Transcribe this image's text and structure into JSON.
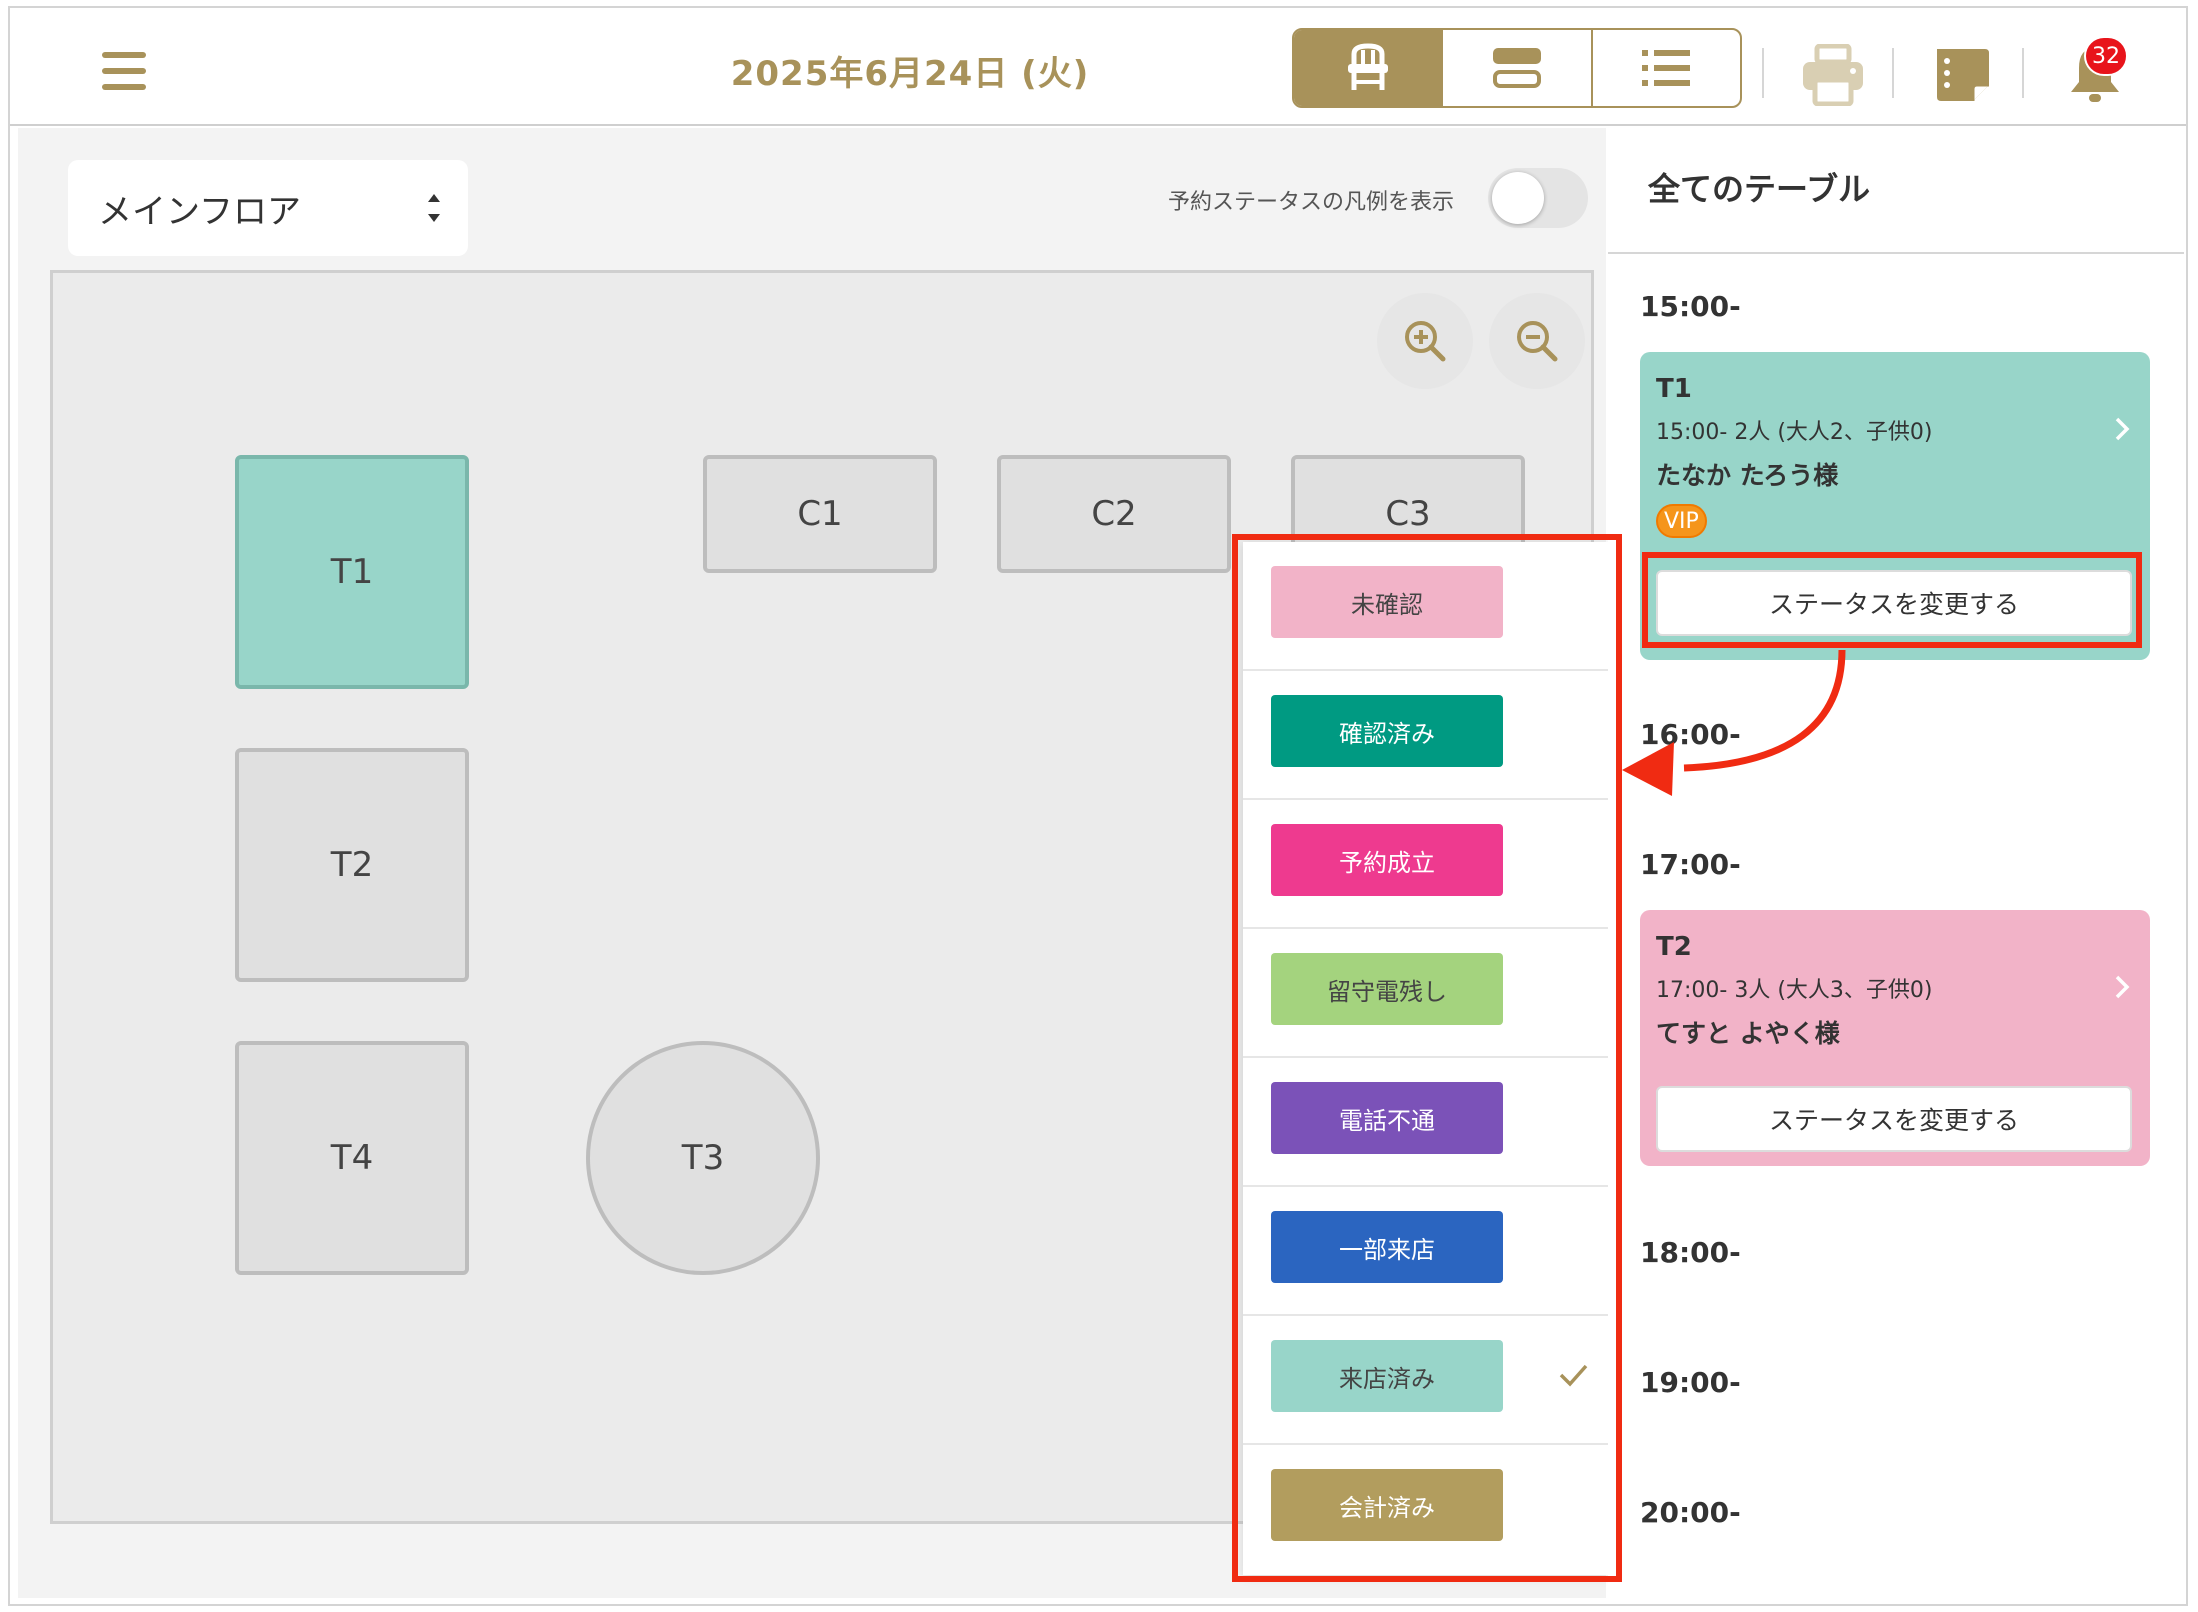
{
  "header": {
    "date": "2025年6月24日 (火)",
    "views": [
      {
        "name": "seat-view-button",
        "icon": "chair-icon",
        "active": true
      },
      {
        "name": "timeline-view-button",
        "icon": "rows-icon",
        "active": false
      },
      {
        "name": "list-view-button",
        "icon": "list-icon",
        "active": false
      }
    ],
    "notifications_count": "32"
  },
  "floor": {
    "selected": "メインフロア",
    "legend_toggle_label": "予約ステータスの凡例を表示",
    "legend_toggle_on": false
  },
  "tables": [
    {
      "id": "T1",
      "label": "T1",
      "shape": "square",
      "selected": true
    },
    {
      "id": "C1",
      "label": "C1",
      "shape": "rect",
      "selected": false
    },
    {
      "id": "C2",
      "label": "C2",
      "shape": "rect",
      "selected": false
    },
    {
      "id": "C3",
      "label": "C3",
      "shape": "rect",
      "selected": false
    },
    {
      "id": "T2",
      "label": "T2",
      "shape": "square",
      "selected": false
    },
    {
      "id": "T4",
      "label": "T4",
      "shape": "square",
      "selected": false
    },
    {
      "id": "T3",
      "label": "T3",
      "shape": "circle",
      "selected": false
    }
  ],
  "status_menu": {
    "items": [
      {
        "label": "未確認",
        "bg": "#f2b3c8",
        "fg": "#444444",
        "checked": false
      },
      {
        "label": "確認済み",
        "bg": "#009a82",
        "fg": "#ffffff",
        "checked": false
      },
      {
        "label": "予約成立",
        "bg": "#ee3a8f",
        "fg": "#ffffff",
        "checked": false
      },
      {
        "label": "留守電残し",
        "bg": "#a4d37e",
        "fg": "#444444",
        "checked": false
      },
      {
        "label": "電話不通",
        "bg": "#7b52b8",
        "fg": "#ffffff",
        "checked": false
      },
      {
        "label": "一部来店",
        "bg": "#2b65c0",
        "fg": "#ffffff",
        "checked": false
      },
      {
        "label": "来店済み",
        "bg": "#98d5c9",
        "fg": "#444444",
        "checked": true
      },
      {
        "label": "会計済み",
        "bg": "#b29d5e",
        "fg": "#ffffff",
        "checked": false
      }
    ]
  },
  "panel": {
    "title": "全てのテーブル",
    "times": [
      "15:00-",
      "16:00-",
      "17:00-",
      "18:00-",
      "19:00-",
      "20:00-"
    ],
    "reservations": [
      {
        "table": "T1",
        "info": "15:00-  2人 (大人2、子供0)",
        "guest": "たなか たろう様",
        "vip": "VIP",
        "status_button": "ステータスを変更する",
        "color": "#98d5c9"
      },
      {
        "table": "T2",
        "info": "17:00-  3人 (大人3、子供0)",
        "guest": "てすと よやく様",
        "status_button": "ステータスを変更する",
        "color": "#f2b3c8"
      }
    ]
  },
  "colors": {
    "accent": "#a8925a",
    "annotation": "#f02b12",
    "badge": "#e8141b"
  }
}
